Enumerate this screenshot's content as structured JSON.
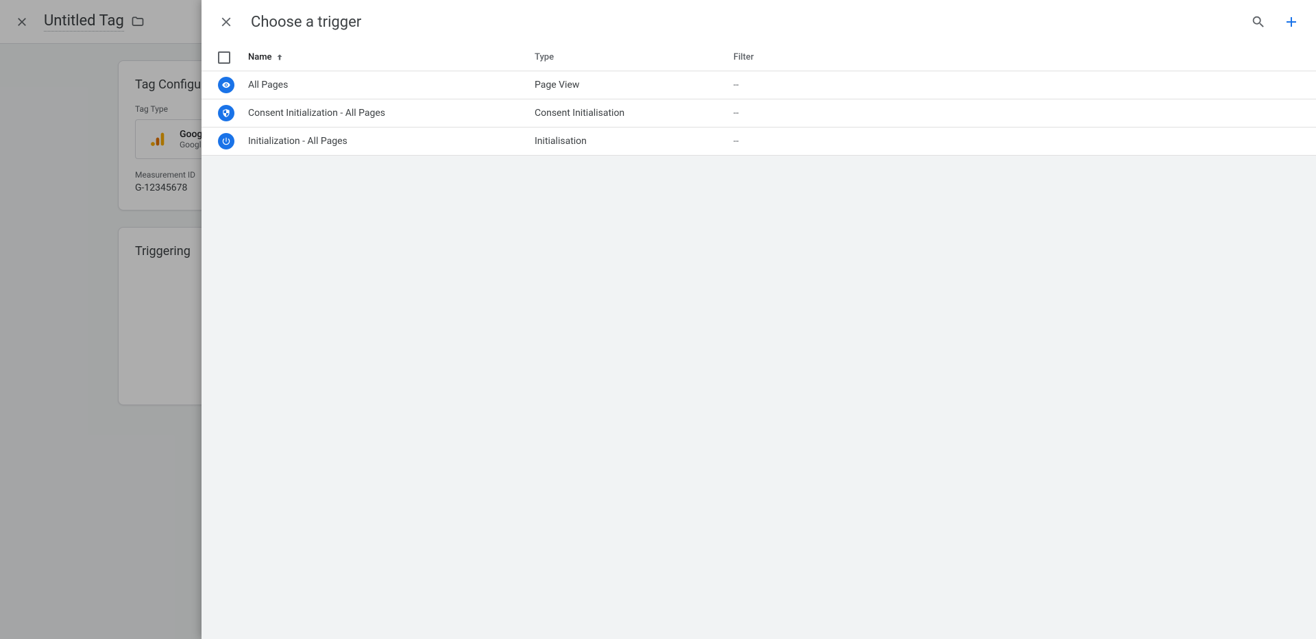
{
  "background": {
    "tag_title": "Untitled Tag",
    "tag_config_heading": "Tag Configuration",
    "tag_type_label": "Tag Type",
    "tag_type_name": "Google Tag",
    "tag_type_sub": "Google",
    "measurement_label": "Measurement ID",
    "measurement_value": "G-12345678",
    "triggering_heading": "Triggering"
  },
  "panel": {
    "title": "Choose a trigger",
    "columns": {
      "name": "Name",
      "type": "Type",
      "filter": "Filter"
    },
    "rows": [
      {
        "icon": "eye",
        "name": "All Pages",
        "type": "Page View",
        "filter": "--"
      },
      {
        "icon": "shield",
        "name": "Consent Initialization - All Pages",
        "type": "Consent Initialisation",
        "filter": "--"
      },
      {
        "icon": "power",
        "name": "Initialization - All Pages",
        "type": "Initialisation",
        "filter": "--"
      }
    ]
  }
}
